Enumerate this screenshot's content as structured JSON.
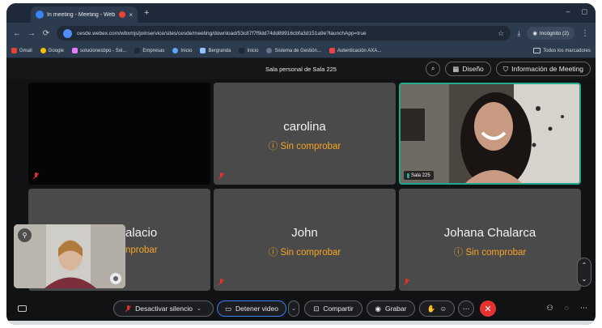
{
  "browser": {
    "tab_title": "In meeting - Meeting - Web",
    "tab_close": "×",
    "new_tab": "+",
    "window_controls": [
      "–",
      "◻"
    ],
    "url": "cesde.webex.com/wbxmjs/joinservice/sites/cesde/meeting/download/53c87f7f9dd74dd89916cbfa3d151a9e?launchApp=true",
    "profile_label": "Incógnito (2)",
    "menu_icon": "more-vert-icon"
  },
  "bookmarks": {
    "items": [
      "Gmail",
      "Google",
      "solucionesbpo - Sol...",
      "Empresas",
      "Inicio",
      "Bergranda",
      "Inicio",
      "Sistema de Gestión...",
      "Autenticación AXA..."
    ],
    "all_bookmarks": "Todos los marcadores"
  },
  "meeting": {
    "room_title": "Sala personal de Sala 225",
    "layout_button": "Diseño",
    "info_button": "Información de Meeting"
  },
  "participants": [
    {
      "name": "",
      "status": "",
      "video": "dark"
    },
    {
      "name": "carolina",
      "status": "Sin comprobar",
      "video": "off"
    },
    {
      "name": "",
      "status": "",
      "video": "on",
      "label": "Sala 225",
      "speaking": true
    },
    {
      "name": "Palacio",
      "status": "nprobar",
      "video": "off"
    },
    {
      "name": "John",
      "status": "Sin comprobar",
      "video": "off"
    },
    {
      "name": "Johana Chalarca",
      "status": "Sin comprobar",
      "video": "off"
    }
  ],
  "status_icon": "ⓘ",
  "controls": {
    "mute": "Desactivar silencio",
    "stop_video": "Detener video",
    "share": "Compartir",
    "record": "Grabar",
    "end": "✕"
  },
  "colors": {
    "accent": "#3b82f6",
    "warning": "#f5a524",
    "speaker_border": "#1fa98a",
    "end_call": "#e5312f",
    "tile": "#4a4a4a"
  }
}
